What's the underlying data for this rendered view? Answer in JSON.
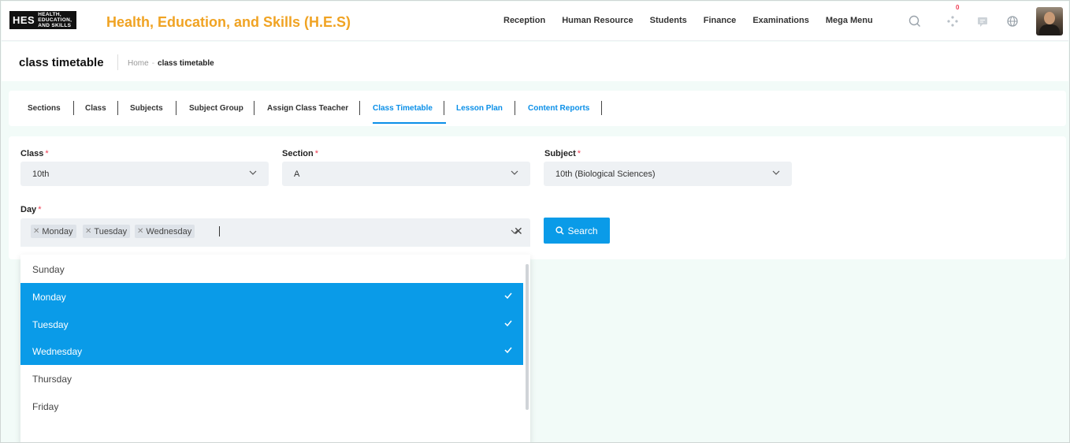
{
  "header": {
    "logo_mark": "HES",
    "logo_line1": "HEALTH,",
    "logo_line2": "EDUCATION,",
    "logo_line3": "AND SKILLS",
    "app_title": "Health, Education, and Skills (H.E.S)",
    "nav": [
      "Reception",
      "Human Resource",
      "Students",
      "Finance",
      "Examinations",
      "Mega Menu"
    ],
    "notification_count": "0",
    "icons": [
      "search-icon",
      "apps-icon",
      "chat-icon",
      "globe-icon",
      "avatar"
    ]
  },
  "page": {
    "title": "class timetable",
    "breadcrumb_home": "Home",
    "breadcrumb_sep": "-",
    "breadcrumb_current": "class timetable"
  },
  "tabs": [
    {
      "label": "Sections",
      "active": false
    },
    {
      "label": "Class",
      "active": false
    },
    {
      "label": "Subjects",
      "active": false
    },
    {
      "label": "Subject Group",
      "active": false
    },
    {
      "label": "Assign Class Teacher",
      "active": false
    },
    {
      "label": "Class Timetable",
      "active": true
    },
    {
      "label": "Lesson Plan",
      "active": false
    },
    {
      "label": "Content Reports",
      "active": false
    }
  ],
  "form": {
    "class_label": "Class",
    "class_value": "10th",
    "section_label": "Section",
    "section_value": "A",
    "subject_label": "Subject",
    "subject_value": "10th (Biological Sciences)",
    "day_label": "Day",
    "required_mark": "*",
    "selected_days": [
      "Monday",
      "Tuesday",
      "Wednesday"
    ],
    "search_label": "Search"
  },
  "day_options": [
    {
      "label": "Sunday",
      "selected": false
    },
    {
      "label": "Monday",
      "selected": true
    },
    {
      "label": "Tuesday",
      "selected": true
    },
    {
      "label": "Wednesday",
      "selected": true
    },
    {
      "label": "Thursday",
      "selected": false
    },
    {
      "label": "Friday",
      "selected": false
    }
  ],
  "colors": {
    "brand_orange": "#f0a323",
    "primary_blue": "#0a9be8",
    "required_red": "#ef3b52"
  }
}
